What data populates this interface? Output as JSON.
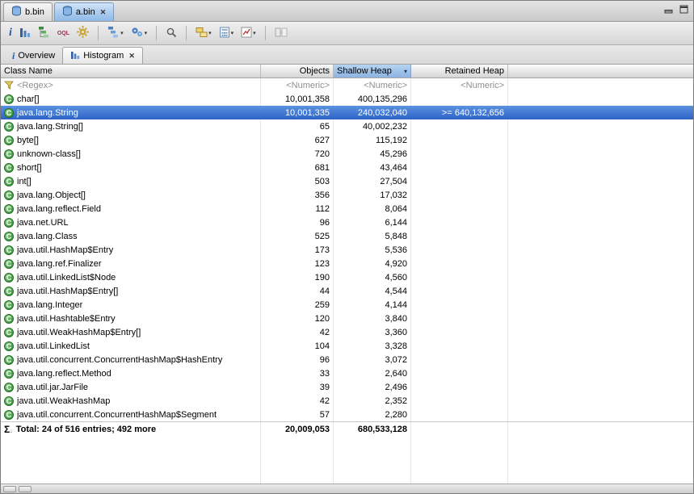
{
  "editor_tabs": [
    {
      "label": "b.bin"
    },
    {
      "label": "a.bin"
    }
  ],
  "window_controls": {
    "icons": [
      "minimize-icon",
      "maximize-icon"
    ]
  },
  "toolbar": {
    "icons": [
      "overview-icon",
      "histogram-icon",
      "dominator-tree-icon",
      "oql-icon",
      "gear-icon",
      "tree-menu-icon",
      "expert-gears-icon",
      "search-icon",
      "group-by-icon",
      "calculator-icon",
      "chart-icon",
      "compare-icon"
    ],
    "oql_label": "OQL"
  },
  "view_tabs": [
    {
      "label": "Overview"
    },
    {
      "label": "Histogram"
    }
  ],
  "table": {
    "class_icon_letter": "C",
    "sum_icon": "Σ",
    "sort_arrow": "▾",
    "columns": [
      {
        "label": "Class Name"
      },
      {
        "label": "Objects"
      },
      {
        "label": "Shallow Heap",
        "sorted": true
      },
      {
        "label": "Retained Heap"
      }
    ],
    "filter_row": {
      "class_name": "<Regex>",
      "objects": "<Numeric>",
      "shallow_heap": "<Numeric>",
      "retained_heap": "<Numeric>"
    },
    "rows": [
      {
        "class_name": "char[]",
        "objects": "10,001,358",
        "shallow_heap": "400,135,296",
        "retained_heap": ""
      },
      {
        "class_name": "java.lang.String",
        "objects": "10,001,335",
        "shallow_heap": "240,032,040",
        "retained_heap": ">= 640,132,656",
        "selected": true
      },
      {
        "class_name": "java.lang.String[]",
        "objects": "65",
        "shallow_heap": "40,002,232",
        "retained_heap": ""
      },
      {
        "class_name": "byte[]",
        "objects": "627",
        "shallow_heap": "115,192",
        "retained_heap": ""
      },
      {
        "class_name": "unknown-class[]",
        "objects": "720",
        "shallow_heap": "45,296",
        "retained_heap": ""
      },
      {
        "class_name": "short[]",
        "objects": "681",
        "shallow_heap": "43,464",
        "retained_heap": ""
      },
      {
        "class_name": "int[]",
        "objects": "503",
        "shallow_heap": "27,504",
        "retained_heap": ""
      },
      {
        "class_name": "java.lang.Object[]",
        "objects": "356",
        "shallow_heap": "17,032",
        "retained_heap": ""
      },
      {
        "class_name": "java.lang.reflect.Field",
        "objects": "112",
        "shallow_heap": "8,064",
        "retained_heap": ""
      },
      {
        "class_name": "java.net.URL",
        "objects": "96",
        "shallow_heap": "6,144",
        "retained_heap": ""
      },
      {
        "class_name": "java.lang.Class",
        "objects": "525",
        "shallow_heap": "5,848",
        "retained_heap": ""
      },
      {
        "class_name": "java.util.HashMap$Entry",
        "objects": "173",
        "shallow_heap": "5,536",
        "retained_heap": ""
      },
      {
        "class_name": "java.lang.ref.Finalizer",
        "objects": "123",
        "shallow_heap": "4,920",
        "retained_heap": ""
      },
      {
        "class_name": "java.util.LinkedList$Node",
        "objects": "190",
        "shallow_heap": "4,560",
        "retained_heap": ""
      },
      {
        "class_name": "java.util.HashMap$Entry[]",
        "objects": "44",
        "shallow_heap": "4,544",
        "retained_heap": ""
      },
      {
        "class_name": "java.lang.Integer",
        "objects": "259",
        "shallow_heap": "4,144",
        "retained_heap": ""
      },
      {
        "class_name": "java.util.Hashtable$Entry",
        "objects": "120",
        "shallow_heap": "3,840",
        "retained_heap": ""
      },
      {
        "class_name": "java.util.WeakHashMap$Entry[]",
        "objects": "42",
        "shallow_heap": "3,360",
        "retained_heap": ""
      },
      {
        "class_name": "java.util.LinkedList",
        "objects": "104",
        "shallow_heap": "3,328",
        "retained_heap": ""
      },
      {
        "class_name": "java.util.concurrent.ConcurrentHashMap$HashEntry",
        "objects": "96",
        "shallow_heap": "3,072",
        "retained_heap": ""
      },
      {
        "class_name": "java.lang.reflect.Method",
        "objects": "33",
        "shallow_heap": "2,640",
        "retained_heap": ""
      },
      {
        "class_name": "java.util.jar.JarFile",
        "objects": "39",
        "shallow_heap": "2,496",
        "retained_heap": ""
      },
      {
        "class_name": "java.util.WeakHashMap",
        "objects": "42",
        "shallow_heap": "2,352",
        "retained_heap": ""
      },
      {
        "class_name": "java.util.concurrent.ConcurrentHashMap$Segment",
        "objects": "57",
        "shallow_heap": "2,280",
        "retained_heap": ""
      }
    ],
    "total_row": {
      "label": "Total: 24 of 516 entries; 492 more",
      "objects": "20,009,053",
      "shallow_heap": "680,533,128",
      "retained_heap": ""
    }
  }
}
